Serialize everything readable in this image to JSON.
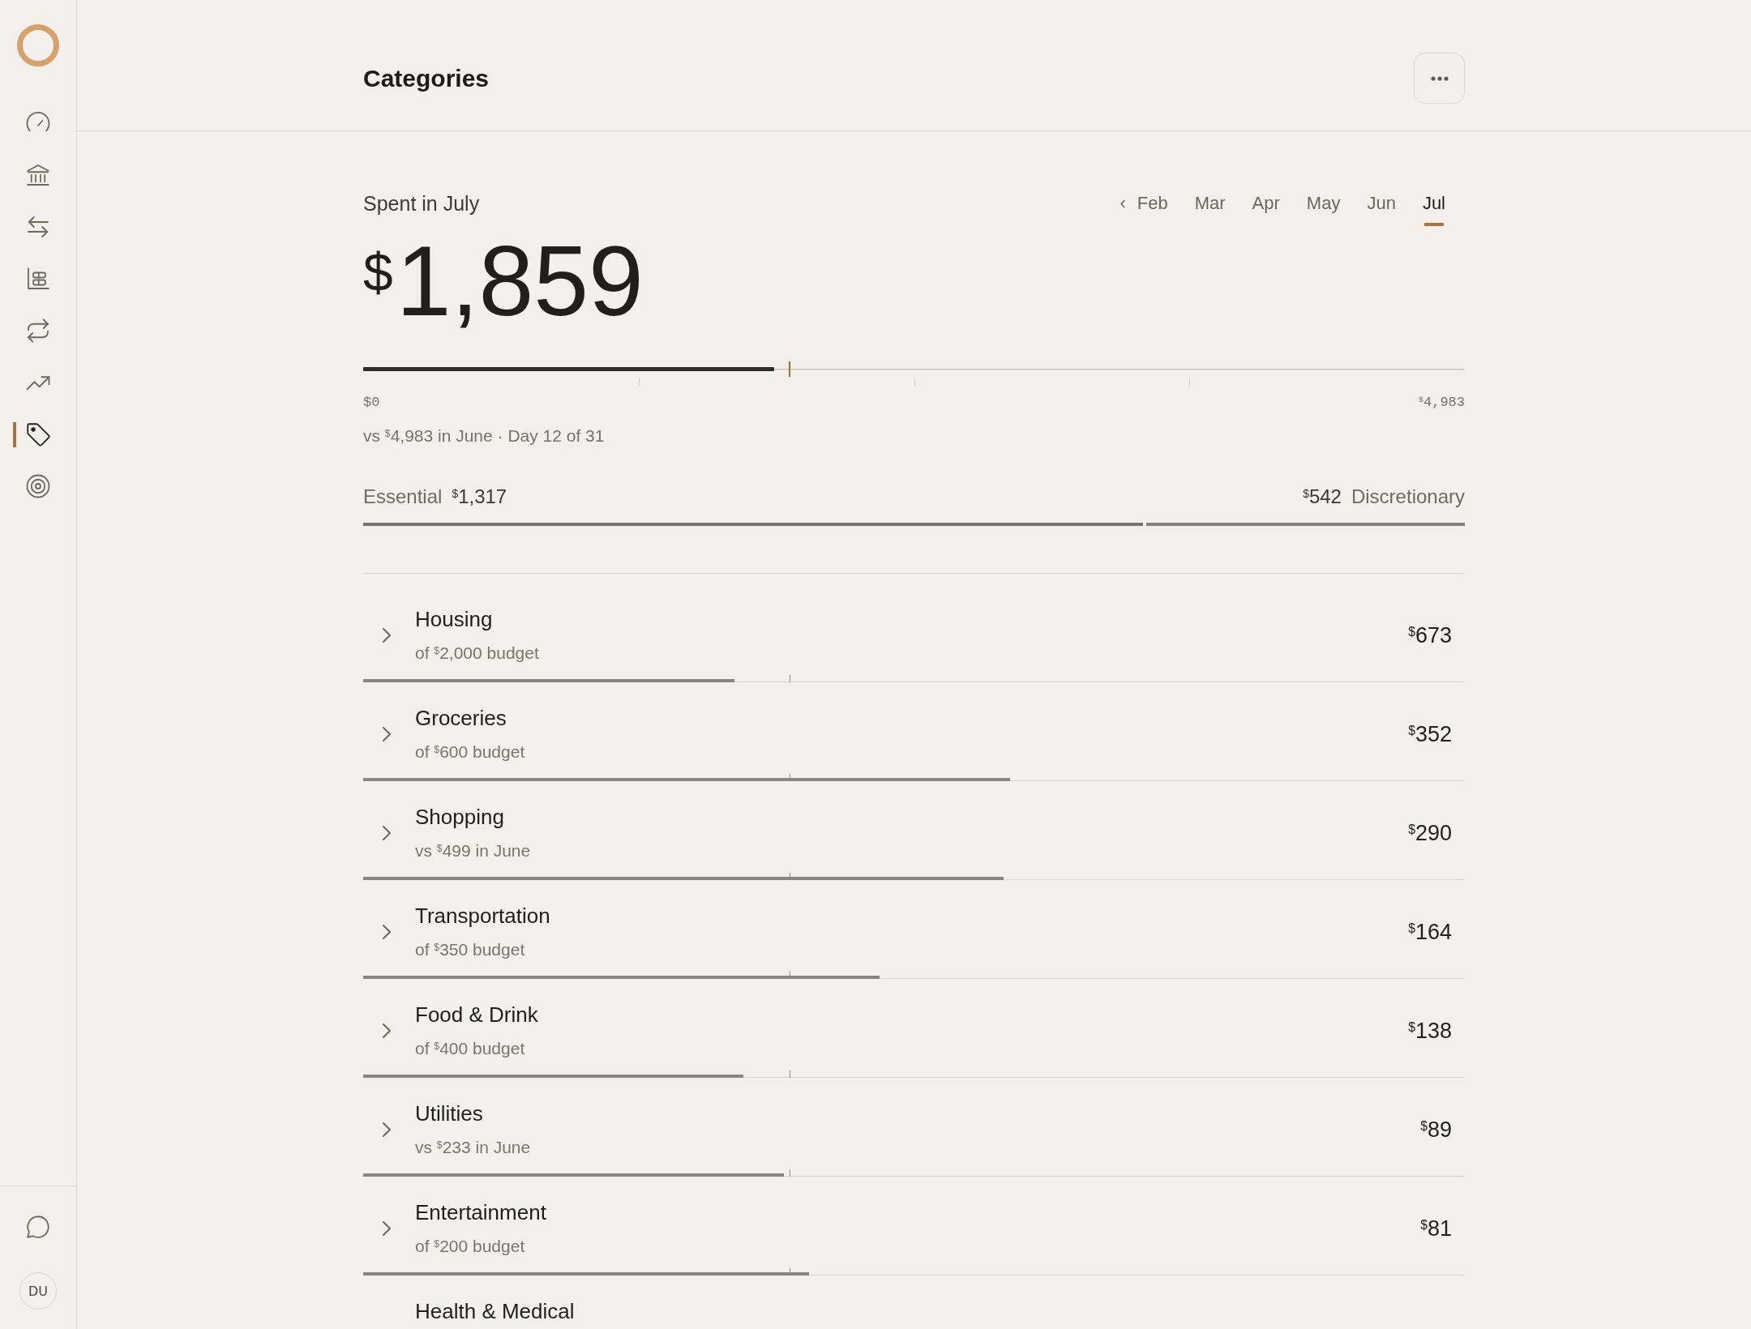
{
  "sidebar": {
    "nav": [
      {
        "selected": false
      },
      {
        "selected": false
      },
      {
        "selected": false
      },
      {
        "selected": false
      },
      {
        "selected": false
      },
      {
        "selected": false
      },
      {
        "selected": true
      },
      {
        "selected": false
      }
    ],
    "user": {
      "initials": "DU"
    }
  },
  "header": {
    "title": "Categories"
  },
  "summary": {
    "label": "Spent in July",
    "months_prev": "‹",
    "months": [
      {
        "label": "Feb",
        "selected": false
      },
      {
        "label": "Mar",
        "selected": false
      },
      {
        "label": "Apr",
        "selected": false
      },
      {
        "label": "May",
        "selected": false
      },
      {
        "label": "Jun",
        "selected": false
      },
      {
        "label": "Jul",
        "selected": true
      }
    ],
    "amount": "$^{$}$1,859",
    "scale": {
      "level": 0.373,
      "min_label": "$0",
      "max_label": "$^{$}$4,983"
    },
    "today_marker": {
      "level": 0.387
    },
    "comparison": "vs $^{$}$4,983 in June · Day 12 of 31"
  },
  "split": {
    "essential": {
      "label": "Essential",
      "amount": "$^{$}$1,317",
      "level": 0.708
    },
    "discretionary": {
      "label": "Discretionary",
      "amount": "$^{$}$542"
    }
  },
  "categories": [
    {
      "name": "Housing",
      "detail": "of $^{$}$2,000 budget",
      "amount": "$^{$}$673",
      "level": 0.337,
      "expanded": false
    },
    {
      "name": "Groceries",
      "detail": "of $^{$}$600 budget",
      "amount": "$^{$}$352",
      "level": 0.587,
      "expanded": false
    },
    {
      "name": "Shopping",
      "detail": "vs $^{$}$499 in June",
      "amount": "$^{$}$290",
      "level": 0.581,
      "expanded": false
    },
    {
      "name": "Transportation",
      "detail": "of $^{$}$350 budget",
      "amount": "$^{$}$164",
      "level": 0.469,
      "expanded": false
    },
    {
      "name": "Food & Drink",
      "detail": "of $^{$}$400 budget",
      "amount": "$^{$}$138",
      "level": 0.345,
      "expanded": false
    },
    {
      "name": "Utilities",
      "detail": "vs $^{$}$233 in June",
      "amount": "$^{$}$89",
      "level": 0.382,
      "expanded": false
    },
    {
      "name": "Entertainment",
      "detail": "of $^{$}$200 budget",
      "amount": "$^{$}$81",
      "level": 0.405,
      "expanded": false
    },
    {
      "name": "Health & Medical"
    }
  ]
}
